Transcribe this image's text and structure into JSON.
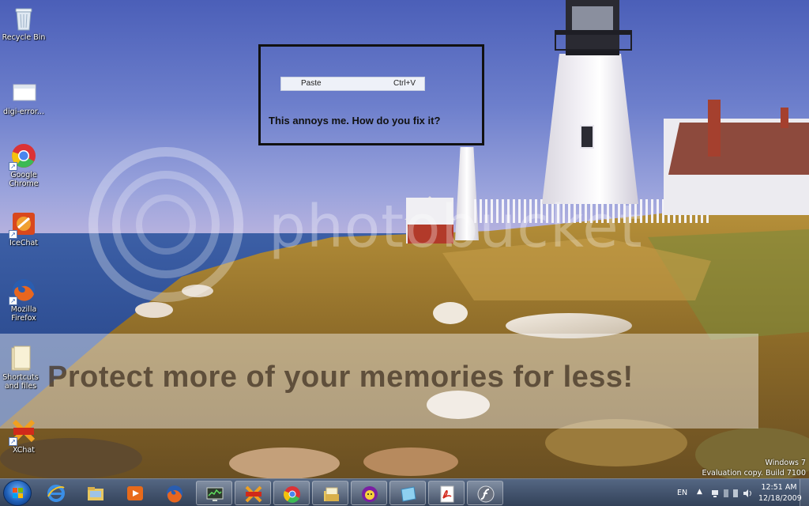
{
  "desktop": {
    "icons": [
      {
        "id": "recycle-bin",
        "label": "Recycle Bin",
        "icon": "recycle-bin-icon"
      },
      {
        "id": "digi-error",
        "label": "digi-error...",
        "icon": "image-file-icon"
      },
      {
        "id": "google-chrome",
        "label": "Google\nChrome",
        "icon": "chrome-icon"
      },
      {
        "id": "icechat",
        "label": "IceChat",
        "icon": "icechat-icon"
      },
      {
        "id": "mozilla-firefox",
        "label": "Mozilla\nFirefox",
        "icon": "firefox-icon"
      },
      {
        "id": "shortcuts-and-files",
        "label": "Shortcuts\nand files",
        "icon": "folder-icon"
      },
      {
        "id": "xchat",
        "label": "XChat",
        "icon": "xchat-icon"
      }
    ]
  },
  "annotation": {
    "menu_item_label": "Paste",
    "menu_item_shortcut": "Ctrl+V",
    "question": "This annoys me. How do you fix it?"
  },
  "watermark": {
    "brand": "photobucket",
    "banner": "Protect more of your memories for less!"
  },
  "windows_build": {
    "line1": "Windows 7",
    "line2": "Evaluation copy. Build 7100"
  },
  "taskbar": {
    "pinned": [
      {
        "name": "internet-explorer",
        "icon": "internet-explorer-icon",
        "active": false
      },
      {
        "name": "windows-explorer",
        "icon": "folder-icon",
        "active": false
      },
      {
        "name": "media-player",
        "icon": "media-player-icon",
        "active": false
      },
      {
        "name": "firefox",
        "icon": "firefox-icon",
        "active": false
      },
      {
        "name": "task-manager",
        "icon": "monitor-icon",
        "active": true
      },
      {
        "name": "xchat",
        "icon": "xchat-icon",
        "active": true
      },
      {
        "name": "chrome",
        "icon": "chrome-icon",
        "active": true
      },
      {
        "name": "windows-explorer-open",
        "icon": "folders-icon",
        "active": true
      },
      {
        "name": "yahoo-messenger",
        "icon": "yahoo-messenger-icon",
        "active": true
      },
      {
        "name": "window-app",
        "icon": "window-icon",
        "active": true
      },
      {
        "name": "adobe-reader",
        "icon": "pdf-icon",
        "active": true
      },
      {
        "name": "flash",
        "icon": "flash-icon",
        "active": true
      }
    ],
    "tray": {
      "language": "EN",
      "time": "12:51 AM",
      "date": "12/18/2009"
    }
  }
}
